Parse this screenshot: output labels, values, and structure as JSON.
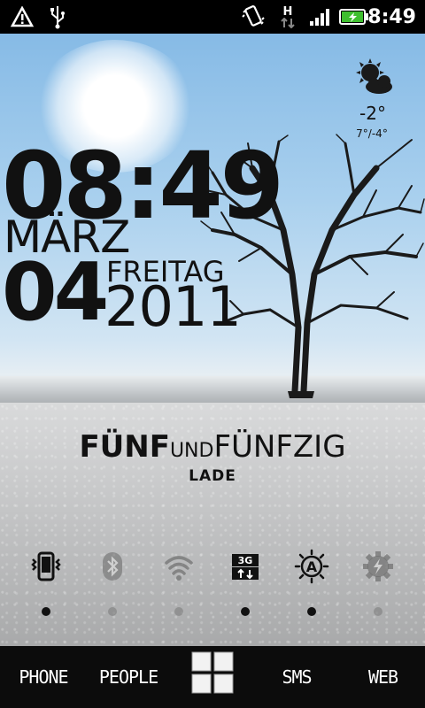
{
  "status_bar": {
    "time": "8:49",
    "network_type": "H",
    "icons": [
      "alert-icon",
      "usb-icon",
      "vibrate-icon",
      "network-h-icon",
      "signal-icon",
      "battery-charging-icon"
    ]
  },
  "clock": {
    "time": "08:49",
    "month": "MÄRZ",
    "day": "04",
    "weekday": "FREITAG",
    "year": "2011"
  },
  "weather": {
    "icon": "partly-cloudy-icon",
    "temperature": "-2°",
    "range": "7°/-4°"
  },
  "battery": {
    "prefix": "FÜNF",
    "connector": "UND",
    "suffix": "FÜNFZIG",
    "status": "LADE"
  },
  "toggles": [
    {
      "name": "vibrate",
      "icon": "vibrate-phone-icon",
      "on": true
    },
    {
      "name": "bluetooth",
      "icon": "bluetooth-icon",
      "on": false
    },
    {
      "name": "wifi",
      "icon": "wifi-icon",
      "on": false
    },
    {
      "name": "3g",
      "icon": "3g-data-icon",
      "on": true
    },
    {
      "name": "auto-brightness",
      "icon": "auto-brightness-icon",
      "on": true
    },
    {
      "name": "sync",
      "icon": "sync-gear-icon",
      "on": false
    }
  ],
  "dock": {
    "phone": "PHONE",
    "people": "PEOPLE",
    "apps_icon": "app-drawer-icon",
    "sms": "SMS",
    "web": "WEB"
  },
  "colors": {
    "status_bar_bg": "#000000",
    "dock_bg": "#0c0c0c",
    "battery_green": "#3fbf2f",
    "text_dark": "#111111"
  }
}
